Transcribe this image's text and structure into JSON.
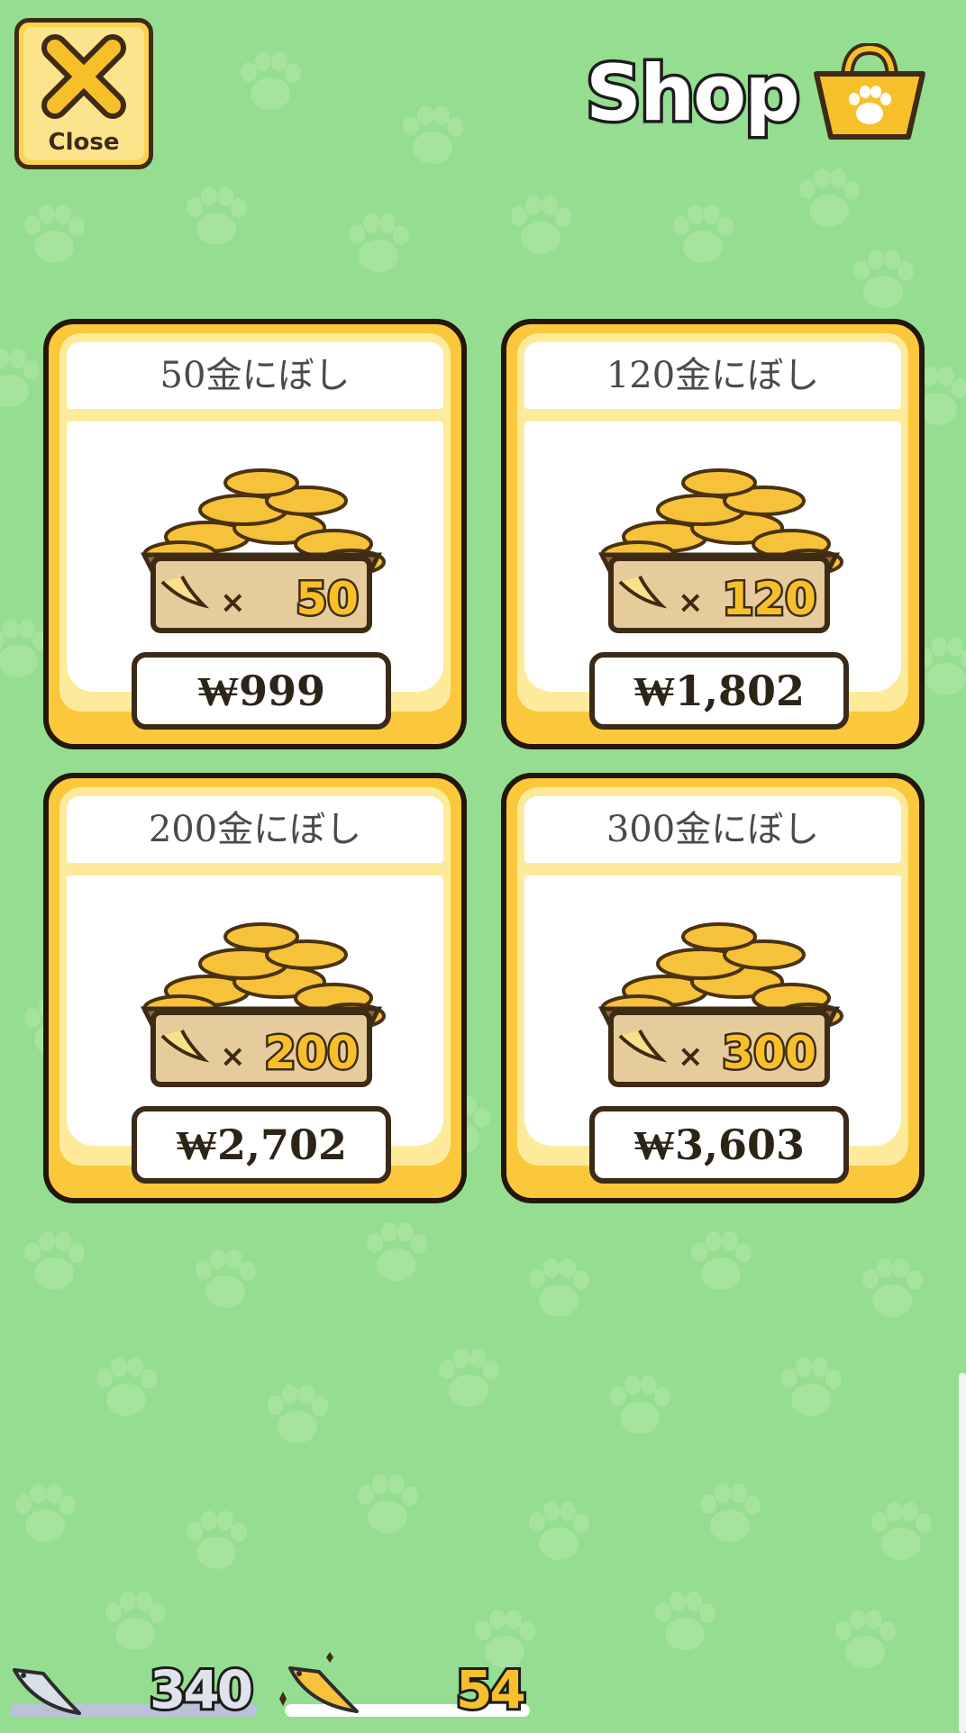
{
  "header": {
    "close_label": "Close",
    "shop_title": "Shop"
  },
  "icons": {
    "close": "close-x-icon",
    "shop": "shopping-bag-paw-icon",
    "crate": "dried-fish-crate-icon",
    "silver_fish": "silver-fish-icon",
    "gold_fish": "gold-fish-icon"
  },
  "products": [
    {
      "name": "50金にぼし",
      "badge_qty": "50",
      "price": "₩999"
    },
    {
      "name": "120金にぼし",
      "badge_qty": "120",
      "price": "₩1,802"
    },
    {
      "name": "200金にぼし",
      "badge_qty": "200",
      "price": "₩2,702"
    },
    {
      "name": "300金にぼし",
      "badge_qty": "300",
      "price": "₩3,603"
    }
  ],
  "crate_badge_prefix": "×",
  "currency": {
    "silver_count": "340",
    "gold_count": "54"
  },
  "colors": {
    "background": "#95dd90",
    "card_gold": "#fbc83c",
    "outline": "#23170c"
  }
}
